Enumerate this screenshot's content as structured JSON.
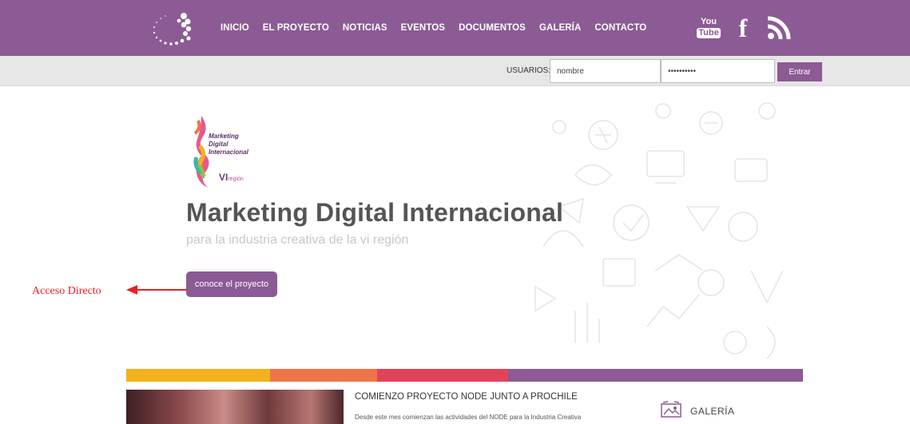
{
  "nav": {
    "items": [
      "INICIO",
      "EL PROYECTO",
      "NOTICIAS",
      "EVENTOS",
      "DOCUMENTOS",
      "GALERÍA",
      "CONTACTO"
    ],
    "social": {
      "youtube_top": "You",
      "youtube_bottom": "Tube",
      "facebook": "f"
    }
  },
  "login": {
    "label": "USUARIOS:",
    "username_value": "nombre",
    "password_value": "••••••••••",
    "submit_label": "Entrar"
  },
  "hero": {
    "logo_lines": [
      "Marketing",
      "Digital",
      "Internacional"
    ],
    "logo_vi": "VI",
    "logo_region": "región",
    "title": "Marketing Digital Internacional",
    "subtitle": "para la industria creativa de la vi región",
    "cta_label": "conoce el proyecto"
  },
  "annotation": {
    "text": "Acceso Directo",
    "color": "#ee1c24"
  },
  "colors": {
    "brand_purple": "#8c5a94",
    "band": [
      "#f2b21b",
      "#f0744a",
      "#e3425b",
      "#8c5a94"
    ]
  },
  "news": {
    "title": "COMIENZO PROYECTO NODE JUNTO A PROCHILE",
    "body": "Desde este mes comienzan las actividades del NODE para la Industria Creativa"
  },
  "gallery": {
    "title": "GALERÍA"
  }
}
